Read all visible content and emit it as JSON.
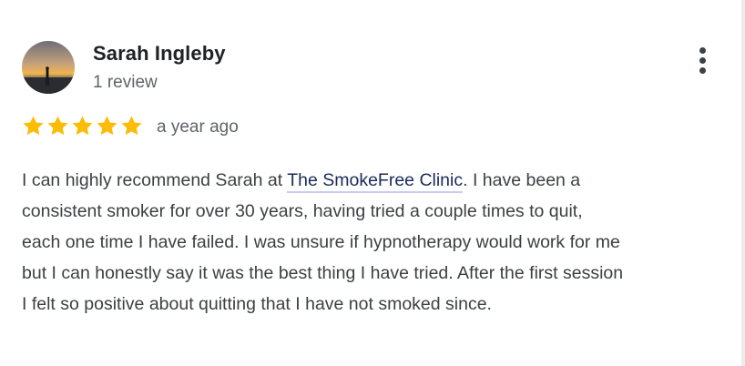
{
  "review": {
    "reviewer_name": "Sarah Ingleby",
    "review_count": "1 review",
    "avatar_icon": "profile-photo-sunset-silhouette",
    "more_icon": "more-vert-icon",
    "rating": 5,
    "rating_max": 5,
    "star_color": "#fbbc04",
    "date": "a year ago",
    "body": {
      "line1_before": "I can highly recommend Sarah at ",
      "link_text": "The SmokeFree Clinic",
      "line1_after": ". I have been a",
      "line2": "consistent smoker for over 30 years, having tried a couple times to quit,",
      "line3": "each one time I have failed. I was unsure if hypnotherapy would work for me",
      "line4": "but I can honestly say it was the best thing I have tried. After the first session",
      "line5": "I felt so positive about quitting that I have not smoked since."
    }
  }
}
